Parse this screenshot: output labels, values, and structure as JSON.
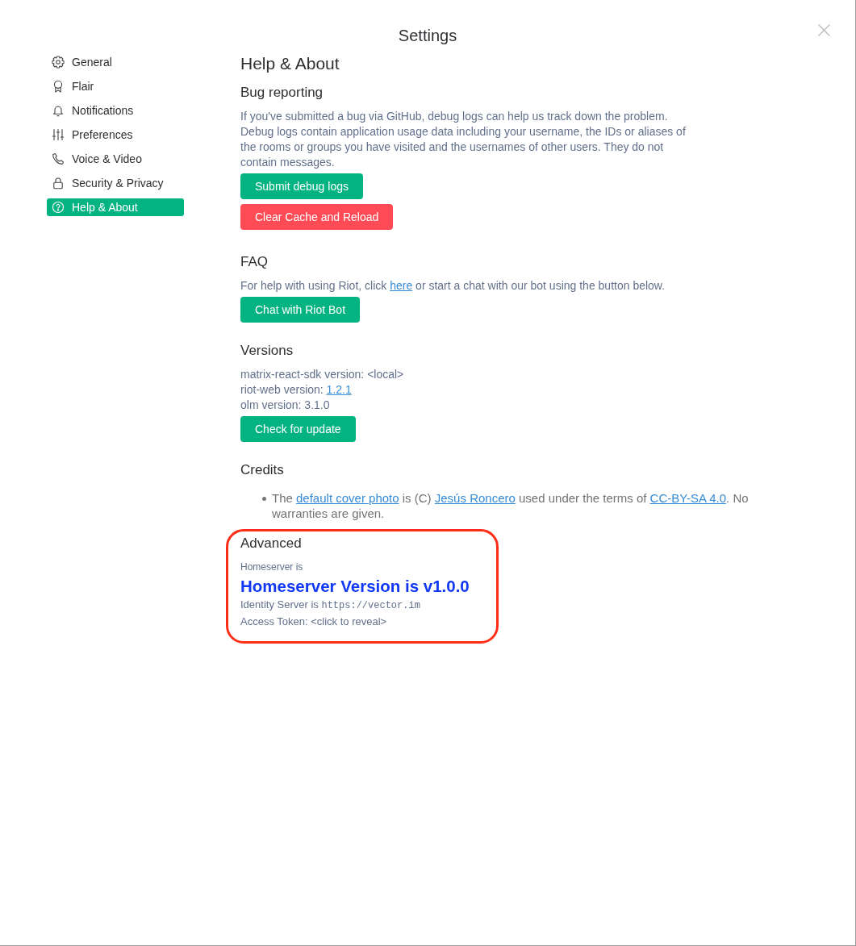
{
  "dialog": {
    "title": "Settings"
  },
  "sidebar": {
    "items": [
      {
        "label": "General",
        "selected": false
      },
      {
        "label": "Flair",
        "selected": false
      },
      {
        "label": "Notifications",
        "selected": false
      },
      {
        "label": "Preferences",
        "selected": false
      },
      {
        "label": "Voice & Video",
        "selected": false
      },
      {
        "label": "Security & Privacy",
        "selected": false
      },
      {
        "label": "Help & About",
        "selected": true
      }
    ]
  },
  "content": {
    "heading": "Help & About",
    "sections": [
      {
        "heading": "Bug reporting",
        "highlighted": false,
        "blocks": [
          {
            "kind": "paragraph",
            "parts": [
              {
                "kind": "text",
                "text": "If you've submitted a bug via GitHub, debug logs can help us track down the problem. Debug logs contain application usage data including your username, the IDs or aliases of the rooms or groups you have visited and the usernames of other users. They do not contain messages."
              }
            ]
          },
          {
            "kind": "button",
            "label": "Submit debug logs",
            "danger": false
          },
          {
            "kind": "button",
            "label": "Clear Cache and Reload",
            "danger": true
          }
        ]
      },
      {
        "heading": "FAQ",
        "highlighted": false,
        "blocks": [
          {
            "kind": "paragraph",
            "parts": [
              {
                "kind": "text",
                "text": "For help with using Riot, click "
              },
              {
                "kind": "link",
                "text": "here"
              },
              {
                "kind": "text",
                "text": " or start a chat with our bot using the button below."
              }
            ]
          },
          {
            "kind": "button",
            "label": "Chat with Riot Bot",
            "danger": false
          }
        ]
      },
      {
        "heading": "Versions",
        "highlighted": false,
        "blocks": [
          {
            "kind": "line",
            "parts": [
              {
                "kind": "text",
                "text": "matrix-react-sdk version: <local>"
              }
            ]
          },
          {
            "kind": "line",
            "parts": [
              {
                "kind": "text",
                "text": "riot-web version: "
              },
              {
                "kind": "link",
                "text": "1.2.1"
              }
            ]
          },
          {
            "kind": "line",
            "parts": [
              {
                "kind": "text",
                "text": "olm version: 3.1.0"
              }
            ]
          },
          {
            "kind": "button",
            "label": "Check for update",
            "danger": false
          }
        ]
      },
      {
        "heading": "Credits",
        "highlighted": false,
        "blocks": [
          {
            "kind": "bullet",
            "parts": [
              {
                "kind": "text",
                "text": "The "
              },
              {
                "kind": "link",
                "text": "default cover photo"
              },
              {
                "kind": "text",
                "text": " is (C) "
              },
              {
                "kind": "link",
                "text": "Jesús Roncero"
              },
              {
                "kind": "text",
                "text": " used under the terms of "
              },
              {
                "kind": "link",
                "text": "CC-BY-SA 4.0"
              },
              {
                "kind": "text",
                "text": ". No warranties are given."
              }
            ]
          }
        ]
      },
      {
        "heading": "Advanced",
        "highlighted": true,
        "blocks": [
          {
            "kind": "small",
            "parts": [
              {
                "kind": "text",
                "text": "Homeserver is"
              }
            ]
          },
          {
            "kind": "banner",
            "text": "Homeserver Version is v1.0.0"
          },
          {
            "kind": "line",
            "parts": [
              {
                "kind": "text",
                "text": "Identity Server is "
              },
              {
                "kind": "code",
                "text": "https://vector.im"
              }
            ]
          },
          {
            "kind": "line",
            "parts": [
              {
                "kind": "text",
                "text": "Access Token: <click to reveal>"
              }
            ]
          }
        ]
      }
    ]
  }
}
